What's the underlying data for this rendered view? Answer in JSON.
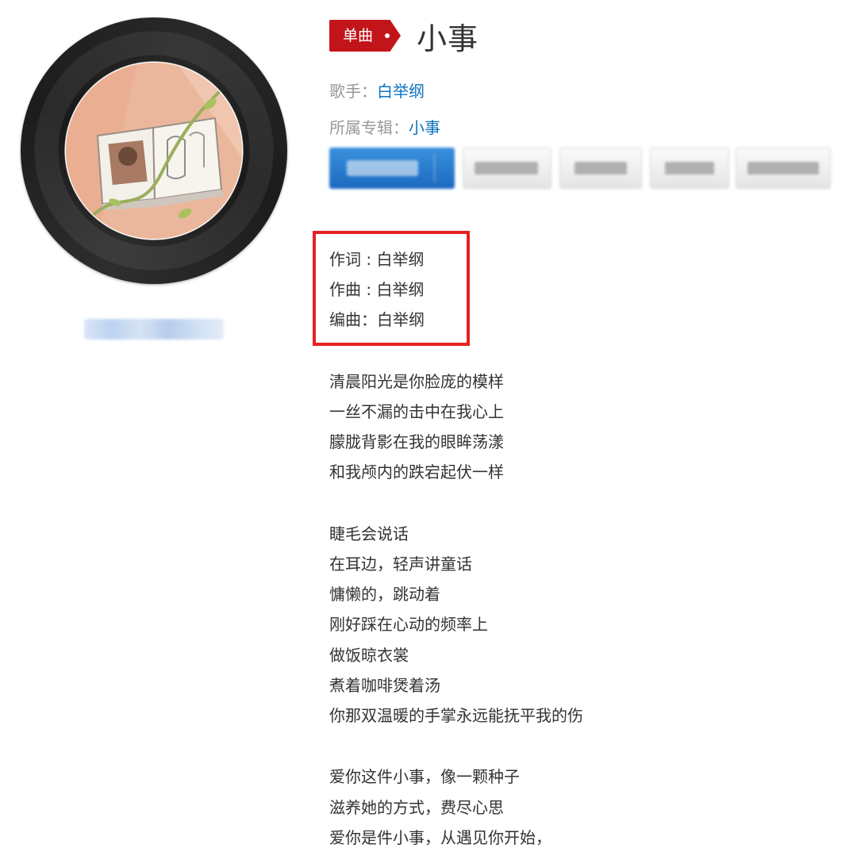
{
  "song": {
    "type_tag": "单曲",
    "title": "小事",
    "singer_label": "歌手：",
    "singer": "白举纲",
    "album_label": "所属专辑：",
    "album": "小事"
  },
  "credits": {
    "lyricist_label": "作词",
    "lyricist": "白举纲",
    "composer_label": "作曲",
    "composer": "白举纲",
    "arranger_label": "编曲：",
    "arranger": "白举纲"
  },
  "lyrics": [
    "清晨阳光是你脸庞的模样",
    "一丝不漏的击中在我心上",
    "朦胧背影在我的眼眸荡漾",
    "和我颅内的跌宕起伏一样",
    "",
    "睫毛会说话",
    "在耳边，轻声讲童话",
    "慵懒的，跳动着",
    "刚好踩在心动的频率上",
    "做饭晾衣裳",
    "煮着咖啡煲着汤",
    "你那双温暖的手掌永远能抚平我的伤",
    "",
    "爱你这件小事，像一颗种子",
    "滋养她的方式，费尽心思",
    "爱你是件小事，从遇见你开始，"
  ],
  "colors": {
    "tag_red": "#c2151a",
    "link_blue": "#0c73c2",
    "highlight_box": "#e62222",
    "play_button_blue": "#1b69c0"
  }
}
